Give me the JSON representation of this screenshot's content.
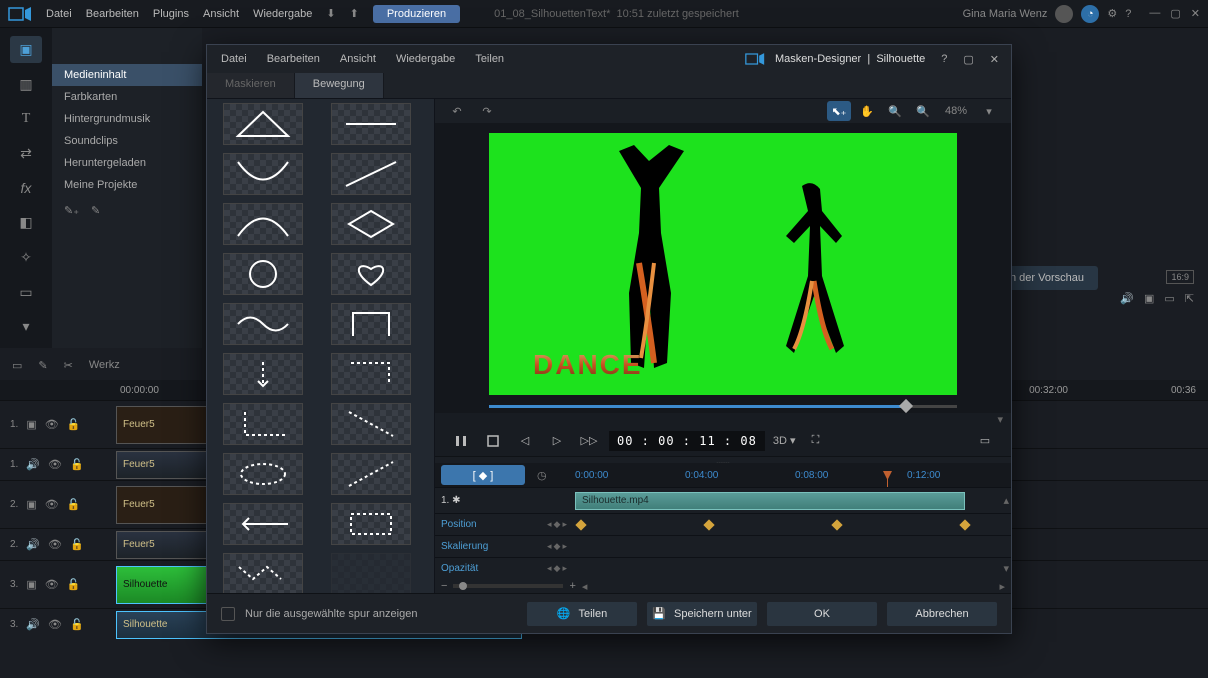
{
  "topbar": {
    "menu": [
      "Datei",
      "Bearbeiten",
      "Plugins",
      "Ansicht",
      "Wiedergabe"
    ],
    "produce_btn": "Produzieren",
    "project_name": "01_08_SilhouettenText*",
    "saved_time": "10:51",
    "saved_text": "zuletzt gespeichert",
    "user_name": "Gina Maria Wenz"
  },
  "media_panel": {
    "categories": [
      "Medieninhalt",
      "Farbkarten",
      "Hintergrundmusik",
      "Soundclips",
      "Heruntergeladen",
      "Meine Projekte"
    ]
  },
  "timeline": {
    "toolbar_label": "Werkz",
    "ruler": [
      "00:00:00",
      "00:32:00",
      "00:36"
    ],
    "tracks": [
      {
        "num": "1.",
        "clip": "Feuer5"
      },
      {
        "num": "1.",
        "audio": "Feuer5"
      },
      {
        "num": "2.",
        "clip": "Feuer5"
      },
      {
        "num": "2.",
        "audio": "Feuer5"
      },
      {
        "num": "3.",
        "clip": "Silhouette"
      },
      {
        "num": "3.",
        "audio": "Silhouette"
      }
    ],
    "render_preview": "Rendern der Vorschau",
    "aspect": "16:9"
  },
  "dialog": {
    "menu": [
      "Datei",
      "Bearbeiten",
      "Ansicht",
      "Wiedergabe",
      "Teilen"
    ],
    "title_left": "Masken-Designer",
    "title_right": "Silhouette",
    "tabs": [
      "Maskieren",
      "Bewegung"
    ],
    "zoom": "48%",
    "preview_text": "DANCE",
    "playback": {
      "timecode": "00 : 00 : 11 : 08",
      "threedee": "3D"
    },
    "kf_ruler": [
      "0:00:00",
      "0:04:00",
      "0:08:00",
      "0:12:00"
    ],
    "clip_label": "Silhouette.mp4",
    "clip_num": "1.",
    "props": [
      "Position",
      "Skalierung",
      "Opazität"
    ],
    "footer": {
      "chk_label": "Nur die ausgewählte spur anzeigen",
      "share": "Teilen",
      "save_as": "Speichern unter",
      "ok": "OK",
      "cancel": "Abbrechen"
    }
  }
}
